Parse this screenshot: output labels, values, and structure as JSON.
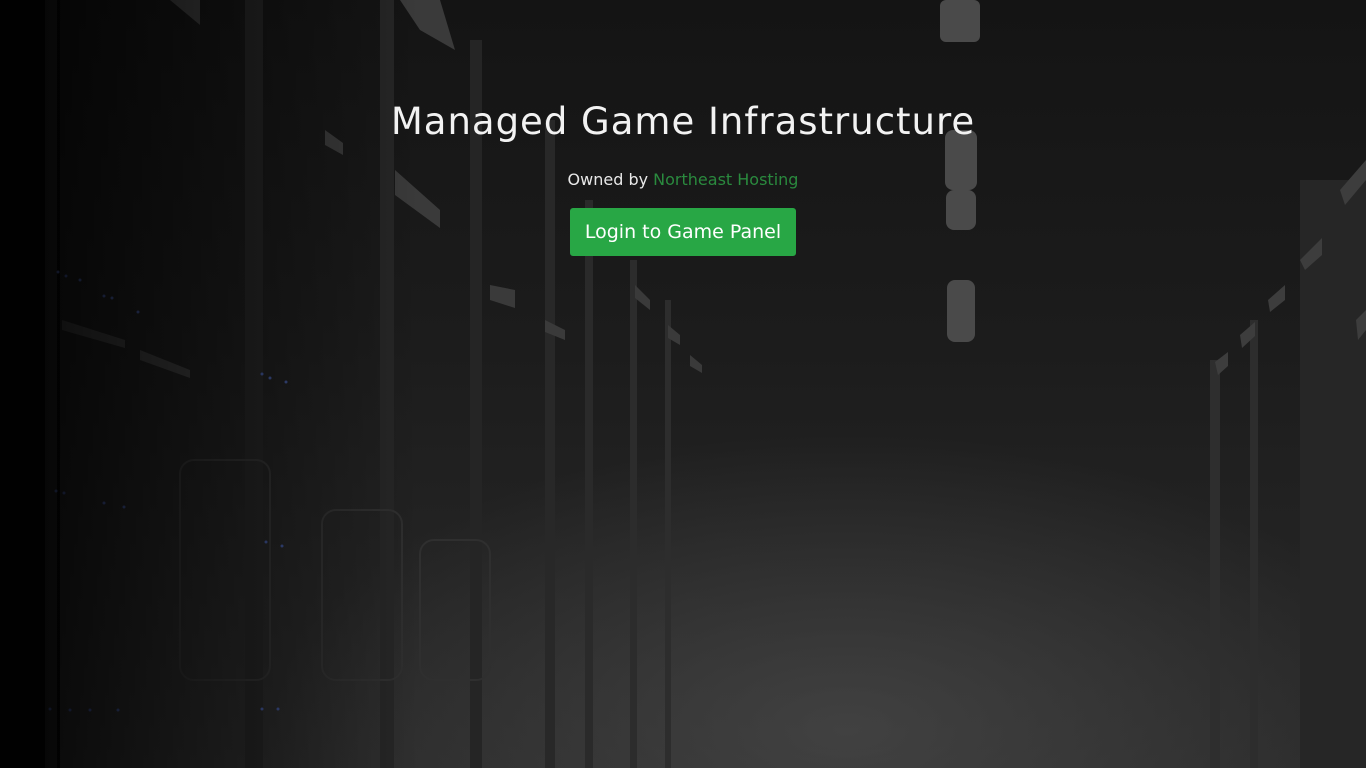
{
  "hero": {
    "title": "Managed Game Infrastructure",
    "owned_prefix": "Owned by",
    "owner_link": "Northeast Hosting",
    "login_button": "Login to Game Panel"
  },
  "colors": {
    "accent": "#28a745",
    "link": "#2a8a3e",
    "background": "#1a1a1a"
  }
}
